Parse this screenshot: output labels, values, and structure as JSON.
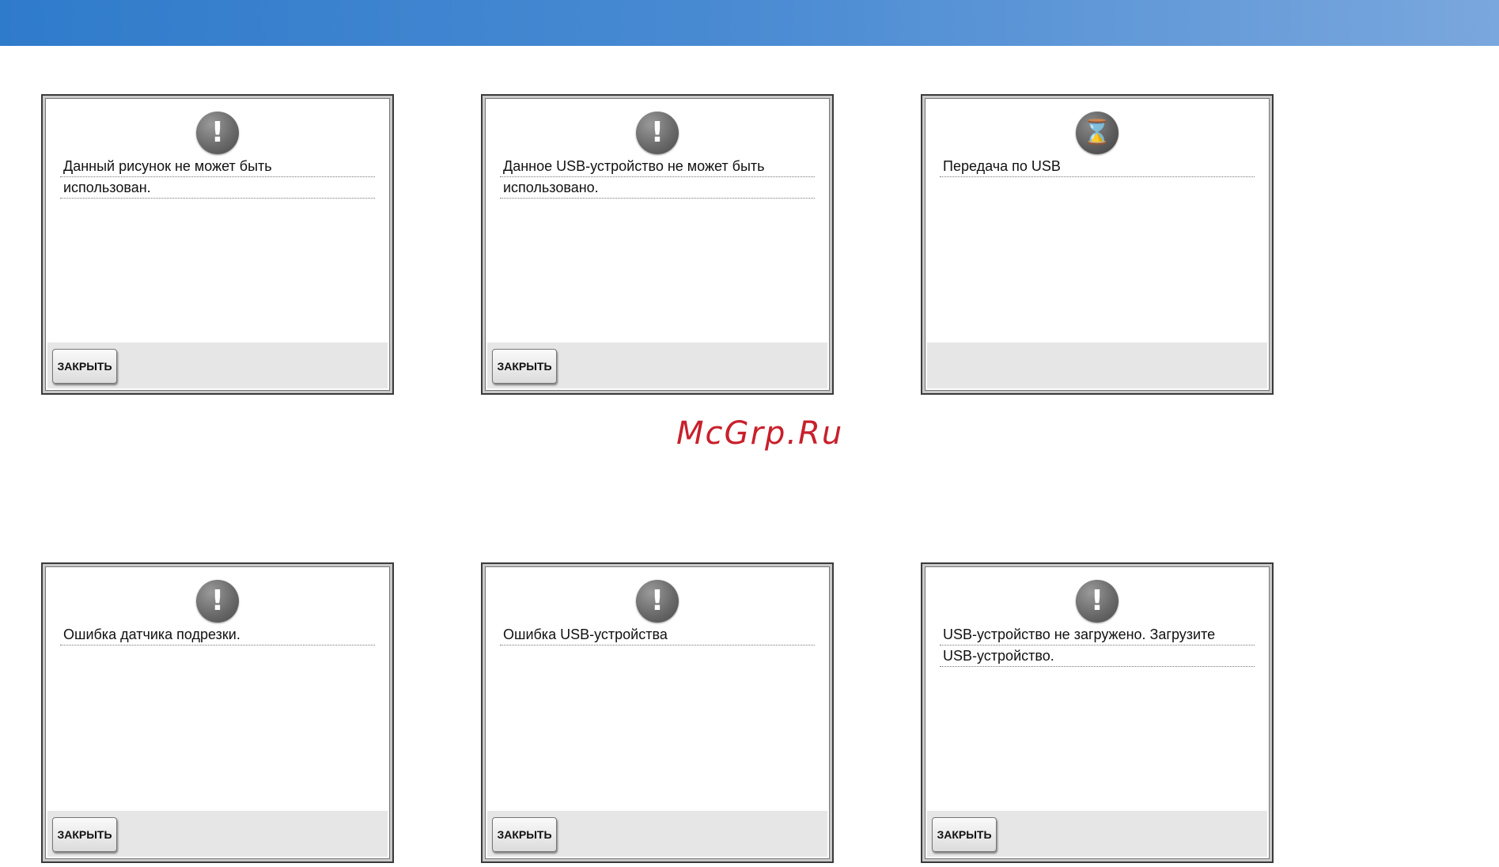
{
  "watermark": "McGrp.Ru",
  "colors": {
    "header_gradient_start": "#2f7bcb",
    "header_gradient_end": "#7aa7dd",
    "watermark": "#c8202c"
  },
  "dialogs": [
    {
      "icon": "exclamation-icon",
      "icon_glyph": "!",
      "lines": [
        "Данный рисунок не может быть",
        "использован."
      ],
      "close_label": "ЗАКРЫТЬ"
    },
    {
      "icon": "exclamation-icon",
      "icon_glyph": "!",
      "lines": [
        "Данное USB-устройство не может быть",
        "использовано."
      ],
      "close_label": "ЗАКРЫТЬ"
    },
    {
      "icon": "hourglass-icon",
      "icon_glyph": "⌛",
      "lines": [
        "Передача по USB"
      ],
      "close_label": ""
    },
    {
      "icon": "exclamation-icon",
      "icon_glyph": "!",
      "lines": [
        "Ошибка датчика подрезки."
      ],
      "close_label": "ЗАКРЫТЬ"
    },
    {
      "icon": "exclamation-icon",
      "icon_glyph": "!",
      "lines": [
        "Ошибка USB-устройства"
      ],
      "close_label": "ЗАКРЫТЬ"
    },
    {
      "icon": "exclamation-icon",
      "icon_glyph": "!",
      "lines": [
        "USB-устройство не загружено. Загрузите",
        "USB-устройство."
      ],
      "close_label": "ЗАКРЫТЬ"
    }
  ]
}
